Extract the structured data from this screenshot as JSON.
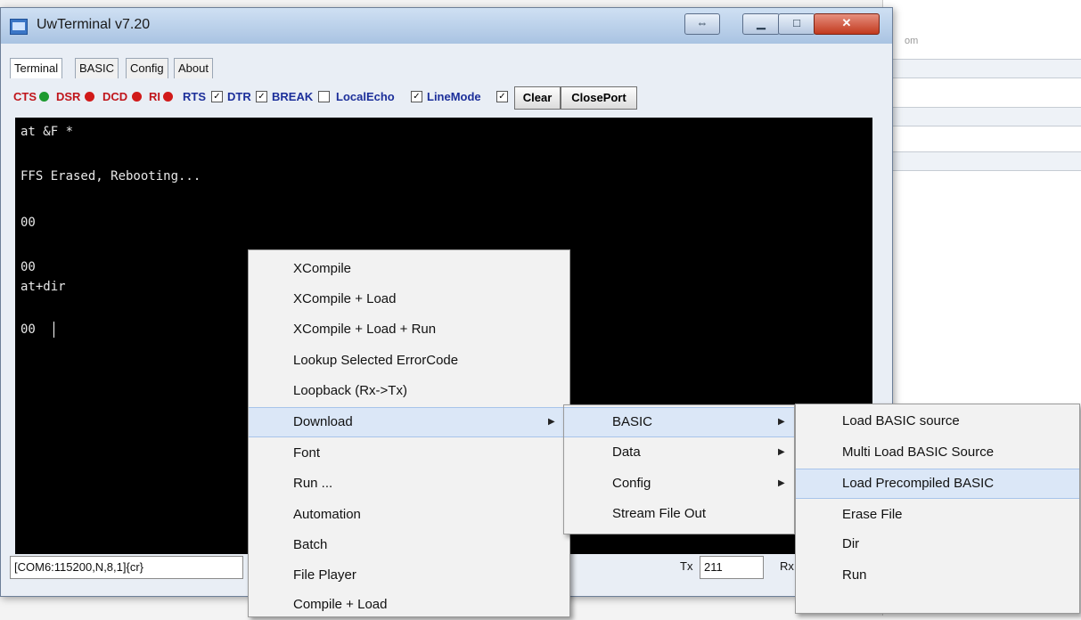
{
  "window": {
    "title": "UwTerminal v7.20"
  },
  "background_app": {
    "partial_text": "om"
  },
  "tabs": [
    "Terminal",
    "BASIC",
    "Config",
    "About"
  ],
  "indicators": [
    {
      "label": "CTS",
      "state_color": "#1d9a2f"
    },
    {
      "label": "DSR",
      "state_color": "#d11a1a"
    },
    {
      "label": "DCD",
      "state_color": "#d11a1a"
    },
    {
      "label": "RI",
      "state_color": "#d11a1a"
    }
  ],
  "toggles": [
    {
      "label": "RTS",
      "checked": true
    },
    {
      "label": "DTR",
      "checked": true
    },
    {
      "label": "BREAK",
      "checked": false
    },
    {
      "label": "LocalEcho",
      "checked": true
    },
    {
      "label": "LineMode",
      "checked": true
    }
  ],
  "buttons": {
    "clear": "Clear",
    "close_port": "ClosePort"
  },
  "terminal": {
    "lines": [
      "at &F *",
      "FFS Erased, Rebooting...",
      "00",
      "00",
      "at+dir",
      "00"
    ]
  },
  "statusbar": {
    "port": "[COM6:115200,N,8,1]{cr}",
    "tx_label": "Tx",
    "tx_value": "211",
    "rx_label": "Rx"
  },
  "context_menu": {
    "items": [
      "XCompile",
      "XCompile + Load",
      "XCompile + Load + Run",
      "Lookup Selected ErrorCode",
      "Loopback (Rx->Tx)",
      "Download",
      "Font",
      "Run ...",
      "Automation",
      "Batch",
      "File Player",
      "Compile + Load"
    ],
    "highlighted": "Download"
  },
  "download_submenu": {
    "items": [
      "BASIC",
      "Data",
      "Config",
      "Stream File Out"
    ],
    "highlighted": "BASIC"
  },
  "basic_submenu": {
    "items": [
      "Load BASIC source",
      "Multi Load BASIC Source",
      "Load Precompiled BASIC",
      "Erase File",
      "Dir",
      "Run"
    ],
    "highlighted": "Load Precompiled BASIC"
  },
  "colors": {
    "label_red": "#c0151b",
    "label_blue": "#1c2f9a",
    "menu_highlight": "#dbe7f7"
  }
}
